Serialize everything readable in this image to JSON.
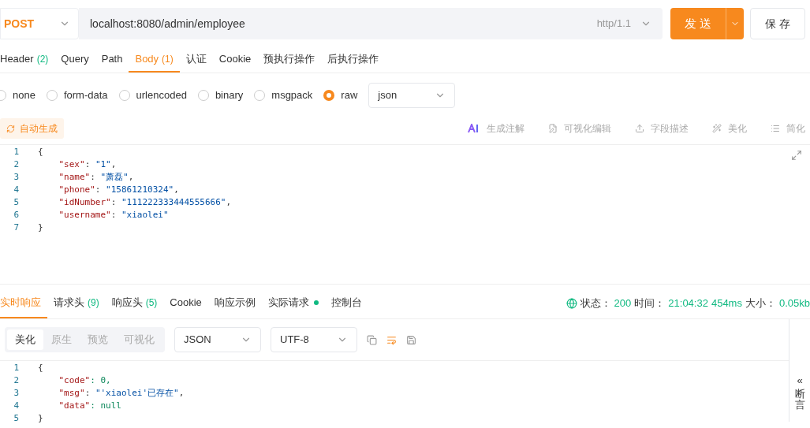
{
  "request": {
    "method": "POST",
    "url": "localhost:8080/admin/employee",
    "protocol": "http/1.1",
    "send": "发 送",
    "save": "保 存"
  },
  "request_tabs": [
    {
      "label": "Header",
      "count": "(2)",
      "selected": false
    },
    {
      "label": "Query",
      "selected": false
    },
    {
      "label": "Path",
      "selected": false
    },
    {
      "label": "Body",
      "count": "(1)",
      "selected": true
    },
    {
      "label": "认证",
      "selected": false
    },
    {
      "label": "Cookie",
      "selected": false
    },
    {
      "label": "预执行操作",
      "selected": false
    },
    {
      "label": "后执行操作",
      "selected": false
    }
  ],
  "body_types": [
    {
      "label": "none",
      "selected": false
    },
    {
      "label": "form-data",
      "selected": false
    },
    {
      "label": "urlencoded",
      "selected": false
    },
    {
      "label": "binary",
      "selected": false
    },
    {
      "label": "msgpack",
      "selected": false
    },
    {
      "label": "raw",
      "selected": true
    }
  ],
  "raw_format": "json",
  "auto_generate": "自动生成",
  "editor_actions": [
    {
      "kind": "ai",
      "label": "生成注解"
    },
    {
      "kind": "edit",
      "label": "可视化编辑"
    },
    {
      "kind": "upload",
      "label": "字段描述"
    },
    {
      "kind": "wand",
      "label": "美化"
    },
    {
      "kind": "list",
      "label": "简化"
    }
  ],
  "request_line_numbers": [
    "1",
    "2",
    "3",
    "4",
    "5",
    "6",
    "7"
  ],
  "response_line_numbers": [
    "1",
    "2",
    "3",
    "4",
    "5"
  ],
  "request_body": [
    "{",
    "    \"sex\": \"1\",",
    "    \"name\": \"萧磊\",",
    "    \"phone\": \"15861210324\",",
    "    \"idNumber\": \"111222333444555666\",",
    "    \"username\": \"xiaolei\"",
    "}"
  ],
  "response_tabs": [
    {
      "label": "实时响应",
      "selected": true
    },
    {
      "label": "请求头",
      "count": "(9)",
      "selected": false
    },
    {
      "label": "响应头",
      "count": "(5)",
      "selected": false
    },
    {
      "label": "Cookie",
      "selected": false
    },
    {
      "label": "响应示例",
      "selected": false
    },
    {
      "label": "实际请求",
      "dot": true,
      "selected": false
    },
    {
      "label": "控制台",
      "selected": false
    }
  ],
  "status": {
    "status_label": "状态：",
    "status": "200",
    "time_label": "时间：",
    "time": "21:04:32",
    "duration": "454ms",
    "size_label": "大小：",
    "size": "0.05kb"
  },
  "view_modes": [
    {
      "label": "美化",
      "selected": true
    },
    {
      "label": "原生",
      "selected": false
    },
    {
      "label": "预览",
      "selected": false
    },
    {
      "label": "可视化",
      "selected": false
    }
  ],
  "response_format": "JSON",
  "encoding": "UTF-8",
  "response_body": [
    "{",
    "    \"code\": 0,",
    "    \"msg\": \"'xiaolei'已存在\",",
    "    \"data\": null",
    "}"
  ],
  "side_panel": {
    "collapse": "«",
    "label": "断言"
  }
}
